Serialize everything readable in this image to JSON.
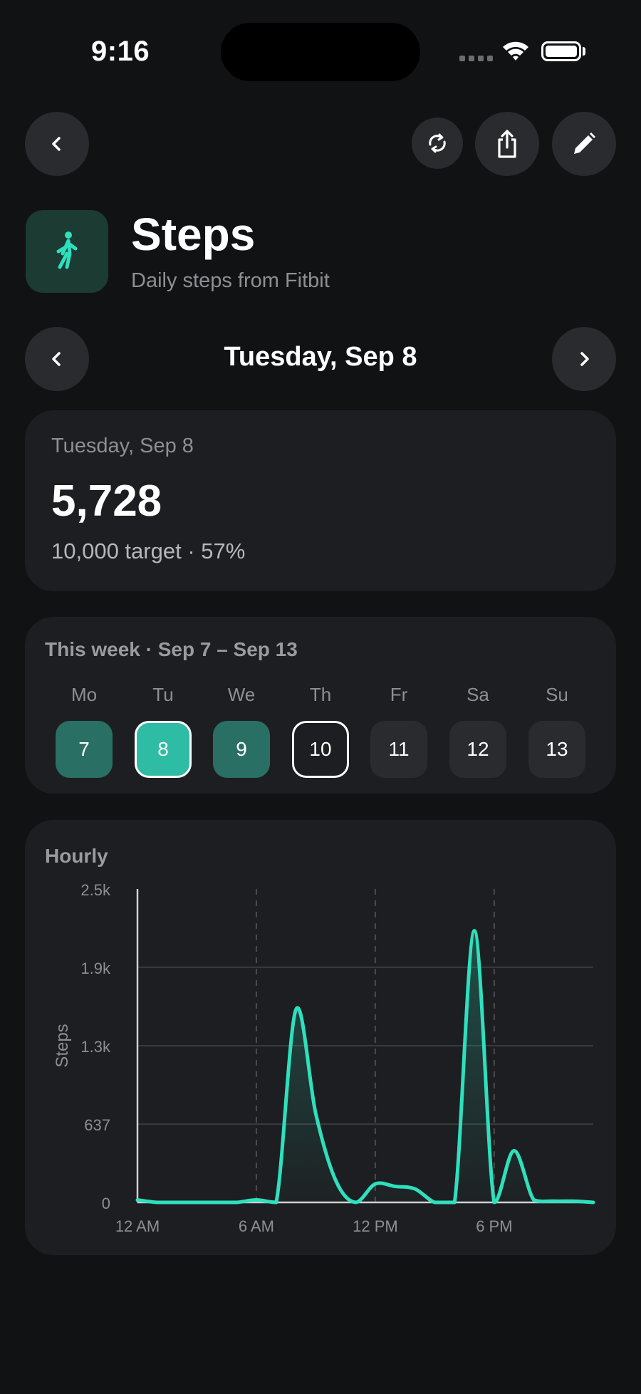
{
  "status_bar": {
    "time": "9:16"
  },
  "header": {
    "title": "Steps",
    "subtitle": "Daily steps from Fitbit",
    "icon": "walking-person-icon",
    "accent": "#2ee0bd"
  },
  "date_nav": {
    "label": "Tuesday, Sep 8"
  },
  "summary": {
    "date": "Tuesday, Sep 8",
    "value": "5,728",
    "target_text": "10,000 target · 57%",
    "progress_percent": 57
  },
  "week": {
    "label": "This week · Sep 7 – Sep 13",
    "days": [
      {
        "name": "Mo",
        "num": "7",
        "state": "done"
      },
      {
        "name": "Tu",
        "num": "8",
        "state": "selected"
      },
      {
        "name": "We",
        "num": "9",
        "state": "done"
      },
      {
        "name": "Th",
        "num": "10",
        "state": "today"
      },
      {
        "name": "Fr",
        "num": "11",
        "state": "future"
      },
      {
        "name": "Sa",
        "num": "12",
        "state": "future"
      },
      {
        "name": "Su",
        "num": "13",
        "state": "future"
      }
    ]
  },
  "chart_data": {
    "type": "area",
    "title": "Hourly",
    "ylabel": "Steps",
    "xlabel": "",
    "ylim": [
      0,
      2550
    ],
    "xlim": [
      0,
      23
    ],
    "ytick_values": [
      0,
      637,
      1275,
      1913,
      2550
    ],
    "ytick_labels": [
      "0",
      "637",
      "1.3k",
      "1.9k",
      "2.5k"
    ],
    "xtick_values": [
      0,
      6,
      12,
      18
    ],
    "xtick_labels": [
      "12 AM",
      "6 AM",
      "12 PM",
      "6 PM"
    ],
    "grid": "horizontal",
    "color": "#2ee0bd",
    "series": [
      {
        "x": [
          0,
          1,
          2,
          3,
          4,
          5,
          6,
          7,
          8,
          9,
          10,
          11,
          12,
          13,
          14,
          15,
          16,
          17,
          18,
          19,
          20,
          21,
          22,
          23
        ],
        "values": [
          20,
          0,
          0,
          0,
          0,
          0,
          20,
          0,
          1570,
          720,
          180,
          0,
          150,
          130,
          110,
          0,
          0,
          2210,
          0,
          420,
          20,
          10,
          10,
          0
        ]
      }
    ]
  }
}
